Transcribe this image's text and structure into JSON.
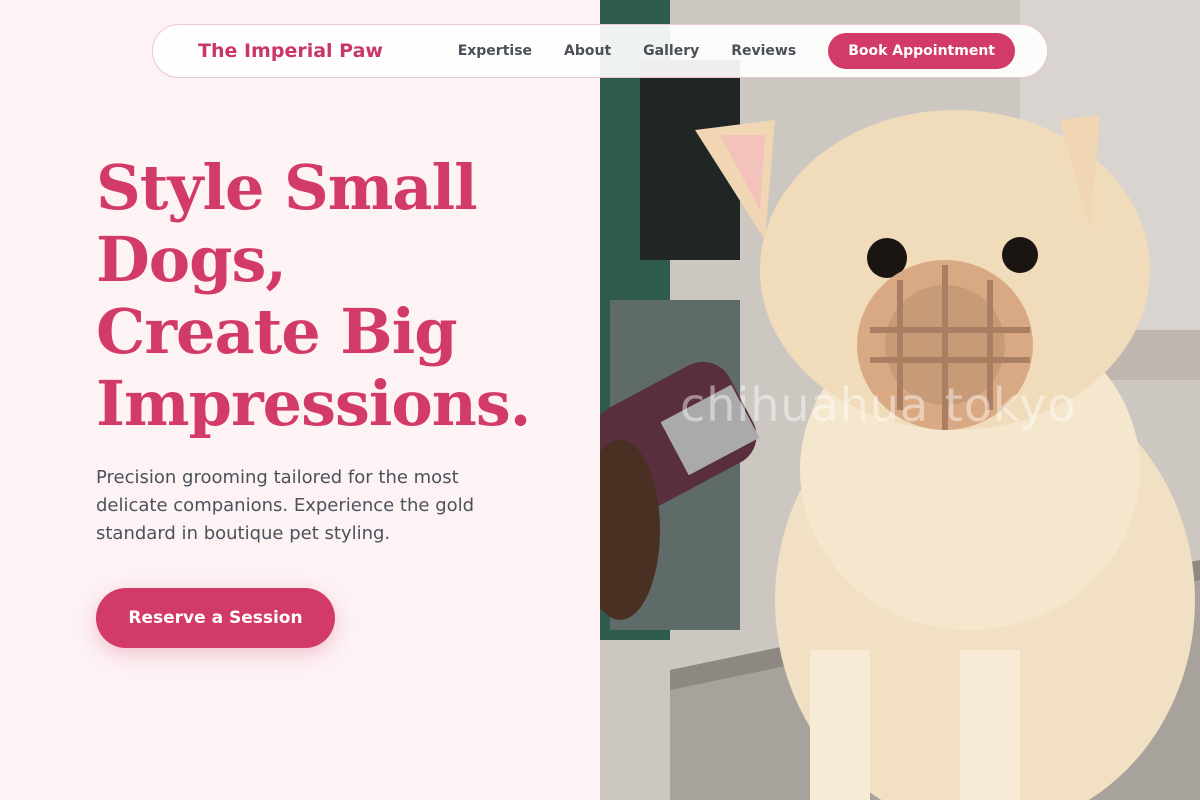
{
  "nav": {
    "brand": "The Imperial Paw",
    "links": [
      "Expertise",
      "About",
      "Gallery",
      "Reviews"
    ],
    "cta": "Book Appointment"
  },
  "hero": {
    "title_lines": [
      "Style Small",
      "Dogs,",
      "Create Big",
      "Impressions."
    ],
    "description": "Precision grooming tailored for the most delicate companions. Experience the gold standard in boutique pet styling.",
    "cta": "Reserve a Session"
  },
  "photo": {
    "watermark": "chihuahua tokyo",
    "subject": "Pomeranian dog wearing a basket muzzle being groomed with clippers"
  },
  "colors": {
    "accent": "#d23a68",
    "background": "#fdf2f4",
    "text_muted": "#4c515b"
  }
}
